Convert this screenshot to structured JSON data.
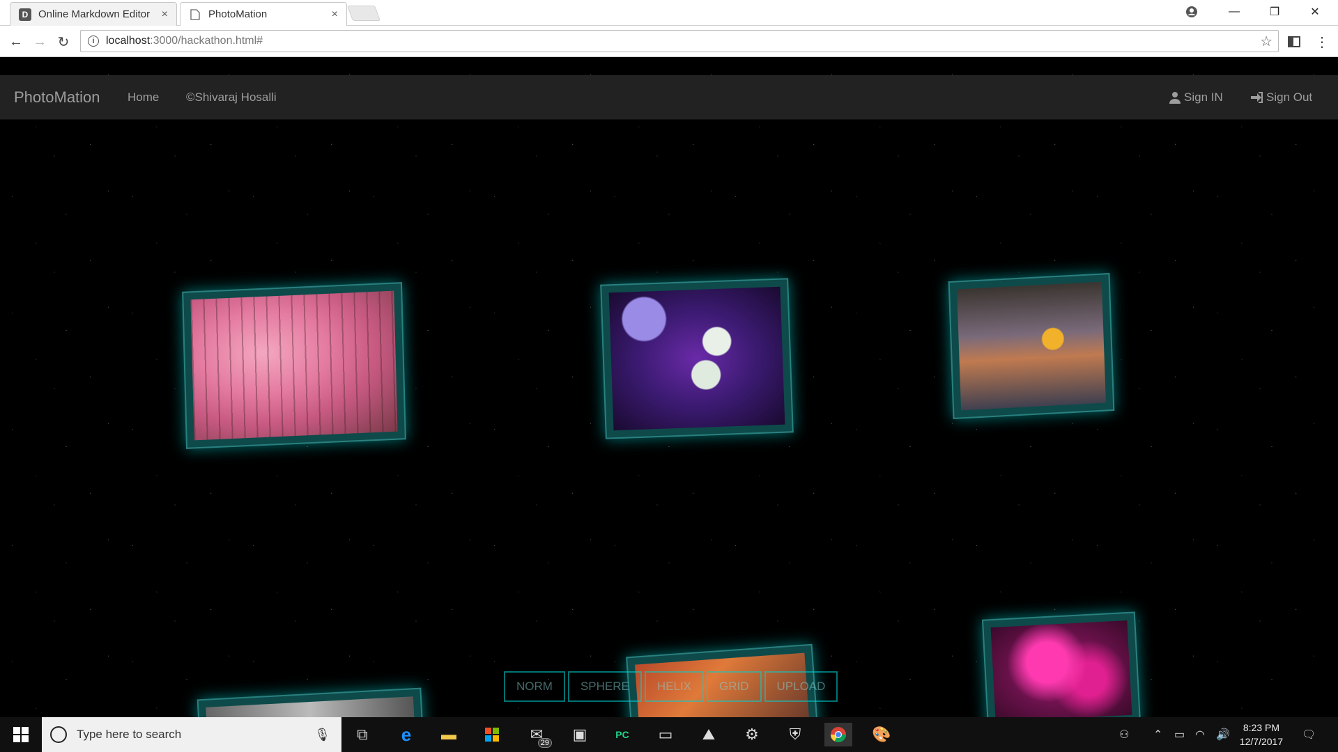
{
  "browser": {
    "tabs": [
      {
        "label": "Online Markdown Editor",
        "favicon": "D"
      },
      {
        "label": "PhotoMation"
      }
    ],
    "url_host": "localhost",
    "url_path": ":3000/hackathon.html#"
  },
  "navbar": {
    "brand": "PhotoMation",
    "links": [
      "Home",
      "©Shivaraj Hosalli"
    ],
    "sign_in": "Sign IN",
    "sign_out": "Sign Out"
  },
  "photos": [
    "pink-blossom-trees",
    "white-flowers-on-purple",
    "moon-over-sea",
    "pink-flower-tree",
    "autumn-leaves",
    "gray-photo"
  ],
  "mode_buttons": [
    "NORM",
    "SPHERE",
    "HELIX",
    "GRID",
    "UPLOAD"
  ],
  "taskbar": {
    "search_placeholder": "Type here to search",
    "mail_badge": "29",
    "time": "8:23 PM",
    "date": "12/7/2017"
  },
  "colors": {
    "card_glow": "#00e5e5",
    "navbar": "#222222",
    "background": "#000000"
  }
}
